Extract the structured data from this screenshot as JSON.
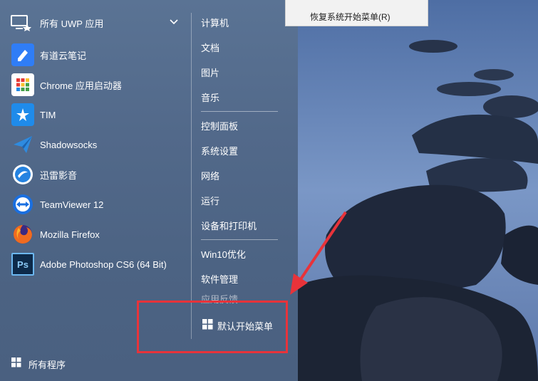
{
  "start_menu": {
    "uwp_header": {
      "label": "所有 UWP 应用",
      "icon": "uwp-apps-icon"
    },
    "apps": [
      {
        "label": "有道云笔记",
        "icon": "youdao-note-icon",
        "color": "#2f7df6"
      },
      {
        "label": "Chrome 应用启动器",
        "icon": "chrome-app-launcher-icon",
        "color": "#ffffff"
      },
      {
        "label": "TIM",
        "icon": "tim-icon",
        "color": "#1f8bea"
      },
      {
        "label": "Shadowsocks",
        "icon": "shadowsocks-icon",
        "color": "#2e8be0"
      },
      {
        "label": "迅雷影音",
        "icon": "xunlei-player-icon",
        "color": "#2583e1"
      },
      {
        "label": "TeamViewer 12",
        "icon": "teamviewer-icon",
        "color": "#1a6fe0"
      },
      {
        "label": "Mozilla Firefox",
        "icon": "firefox-icon",
        "color": "#f06b1f"
      },
      {
        "label": "Adobe Photoshop CS6 (64 Bit)",
        "icon": "photoshop-icon",
        "color": "#0d2a4a"
      }
    ],
    "all_programs": "所有程序",
    "right_group_1": [
      "计算机",
      "文档",
      "图片",
      "音乐"
    ],
    "right_group_2": [
      "控制面板",
      "系统设置",
      "网络",
      "运行",
      "设备和打印机"
    ],
    "right_group_3": [
      "Win10优化",
      "软件管理"
    ],
    "right_faded": "应用反馈",
    "default_start_menu": "默认开始菜单"
  },
  "context_menu": {
    "restore_label": "恢复系统开始菜单(R)"
  },
  "colors": {
    "highlight": "#e8333a",
    "panel": "#52698a"
  }
}
